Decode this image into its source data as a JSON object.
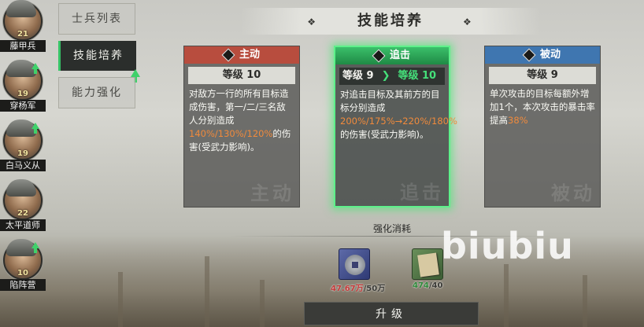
{
  "heroes": [
    {
      "name": "藤甲兵",
      "level": "21"
    },
    {
      "name": "穿杨军",
      "level": "19"
    },
    {
      "name": "白马义从",
      "level": "19"
    },
    {
      "name": "太平道师",
      "level": "22"
    },
    {
      "name": "陷阵营",
      "level": "10"
    }
  ],
  "tabs": [
    "士兵列表",
    "技能培养",
    "能力强化"
  ],
  "title": "技能培养",
  "cards": {
    "active": {
      "type": "主动",
      "level": "等级 10",
      "desc_parts": [
        "对敌方一行的所有目标造成伤害，第一/二/三名敌人分别造成",
        "140%/130%/120%",
        "的伤害(受武力影响)。"
      ],
      "watermark": "主动",
      "color": "#b84d3e"
    },
    "chase": {
      "type": "追击",
      "level_cur": "等级 9",
      "level_next": "等级 10",
      "desc_parts": [
        "对追击目标及其前方的目标分别造成",
        "200%/175%→220%/180%",
        "的伤害(受武力影响)。"
      ],
      "watermark": "追击",
      "color": "#3bbf6a"
    },
    "passive": {
      "type": "被动",
      "level": "等级 9",
      "desc_parts": [
        "单次攻击的目标每额外增加1个，本次攻击的暴击率提高",
        "38%"
      ],
      "watermark": "被动",
      "color": "#3f76b0"
    }
  },
  "consume": {
    "label": "强化消耗",
    "coin": {
      "have": "47.67万",
      "need": "/50万"
    },
    "book": {
      "have": "474",
      "need": "/40"
    }
  },
  "upgrade_button": "升级",
  "watermark_text": "biubiu"
}
